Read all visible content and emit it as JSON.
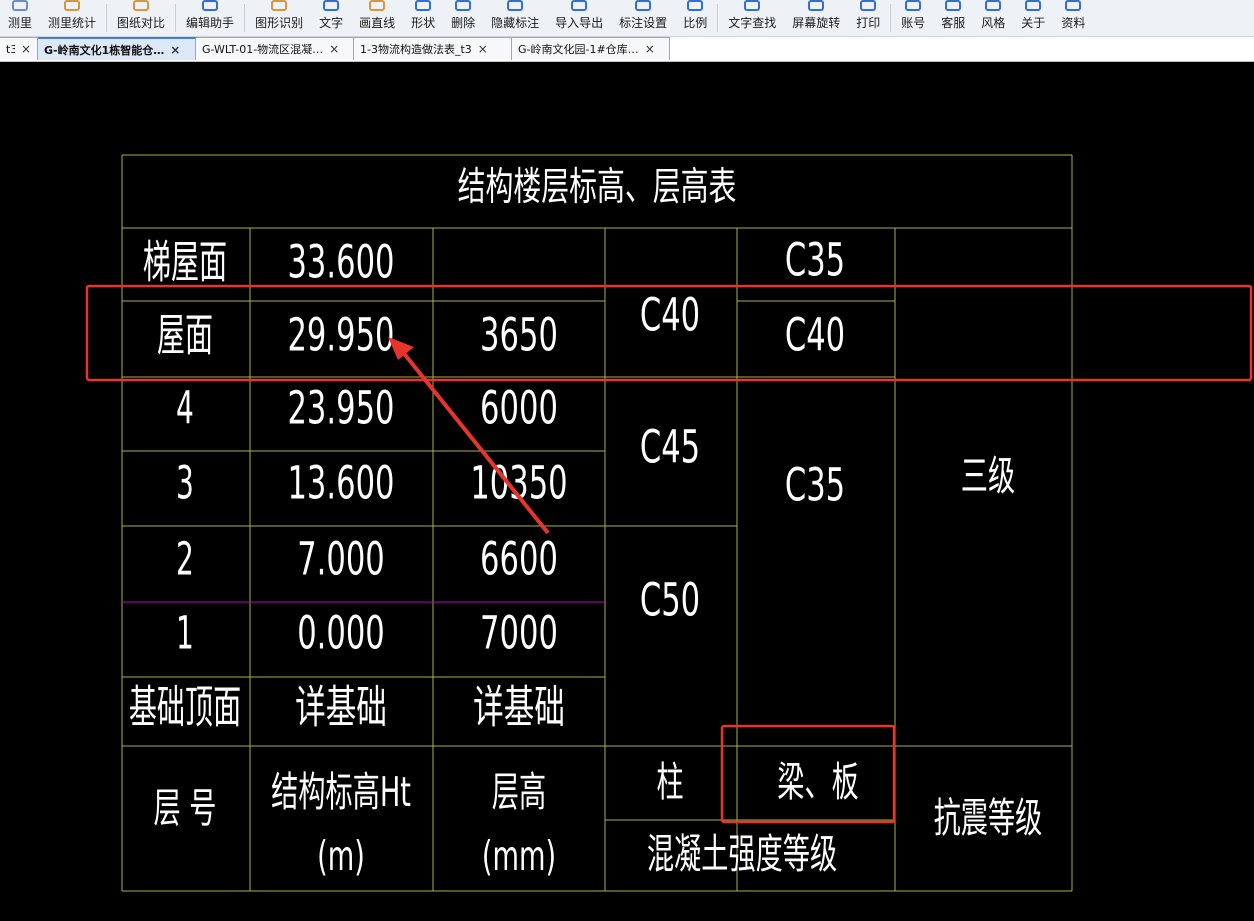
{
  "toolbar": {
    "items": [
      {
        "label": "测里",
        "icon": "ruler-icon",
        "color": "#6b8cc6"
      },
      {
        "label": "测里统计",
        "icon": "measure-stats-icon",
        "color": "#d9963a"
      },
      {
        "sep": true
      },
      {
        "label": "图纸对比",
        "icon": "compare-icon",
        "color": "#d9963a"
      },
      {
        "sep": true
      },
      {
        "label": "编辑助手",
        "icon": "edit-assistant-icon",
        "color": "#2f6fd6"
      },
      {
        "sep": true
      },
      {
        "label": "图形识别",
        "icon": "shape-recognize-icon",
        "color": "#d9963a"
      },
      {
        "label": "文字",
        "icon": "text-icon",
        "color": "#2f6fd6"
      },
      {
        "label": "画直线",
        "icon": "line-icon",
        "color": "#d9963a"
      },
      {
        "label": "形状",
        "icon": "shape-icon",
        "color": "#2f6fd6"
      },
      {
        "label": "删除",
        "icon": "delete-icon",
        "color": "#2f6fd6"
      },
      {
        "label": "隐藏标注",
        "icon": "hide-annotation-icon",
        "color": "#2f6fd6"
      },
      {
        "label": "导入导出",
        "icon": "import-export-icon",
        "color": "#2f6fd6"
      },
      {
        "label": "标注设置",
        "icon": "annotation-settings-icon",
        "color": "#2f6fd6"
      },
      {
        "label": "比例",
        "icon": "scale-icon",
        "color": "#2f6fd6"
      },
      {
        "sep": true
      },
      {
        "label": "文字查找",
        "icon": "text-search-icon",
        "color": "#2f6fd6"
      },
      {
        "label": "屏幕旋转",
        "icon": "rotate-icon",
        "color": "#2f6fd6"
      },
      {
        "label": "打印",
        "icon": "print-icon",
        "color": "#2f6fd6"
      },
      {
        "sep": true
      },
      {
        "label": "账号",
        "icon": "account-icon",
        "color": "#2f6fd6"
      },
      {
        "label": "客服",
        "icon": "support-icon",
        "color": "#2f6fd6"
      },
      {
        "label": "风格",
        "icon": "style-icon",
        "color": "#2f6fd6"
      },
      {
        "label": "关于",
        "icon": "about-icon",
        "color": "#2f6fd6"
      },
      {
        "label": "资料",
        "icon": "documents-icon",
        "color": "#2f6fd6"
      }
    ]
  },
  "tabs": [
    {
      "label": "t3",
      "active": false
    },
    {
      "label": "G-岭南文化1栋智能仓…",
      "active": true
    },
    {
      "label": "G-WLT-01-物流区混凝…",
      "active": false
    },
    {
      "label": "1-3物流构造做法表_t3",
      "active": false
    },
    {
      "label": "G-岭南文化园-1#仓库…",
      "active": false
    }
  ],
  "tab_close_glyph": "×",
  "table": {
    "title": "结构楼层标高、层高表",
    "rows": [
      {
        "floor": "梯屋面",
        "elevation": "33.600",
        "height": ""
      },
      {
        "floor": "屋面",
        "elevation": "29.950",
        "height": "3650"
      },
      {
        "floor": "4",
        "elevation": "23.950",
        "height": "6000"
      },
      {
        "floor": "3",
        "elevation": "13.600",
        "height": "10350"
      },
      {
        "floor": "2",
        "elevation": "7.000",
        "height": "6600"
      },
      {
        "floor": "1",
        "elevation": "0.000",
        "height": "7000"
      },
      {
        "floor": "基础顶面",
        "elevation": "详基础",
        "height": "详基础"
      }
    ],
    "column_grades": [
      "C40",
      "C45",
      "C50"
    ],
    "beam_grades": [
      "C35",
      "C40",
      "C35"
    ],
    "seismic": "三级",
    "header": {
      "floor": "层  号",
      "elevation_l1": "结构标高Ht",
      "elevation_l2": "(m)",
      "height_l1": "层高",
      "height_l2": "(mm)",
      "column": "柱",
      "beam": "梁、板",
      "concrete": "混凝土强度等级",
      "seismic": "抗震等级"
    }
  },
  "colors": {
    "grid": "#a8b04a",
    "accent_line": "#c000c0",
    "annotation": "#e8352b",
    "text": "#ffffff"
  }
}
